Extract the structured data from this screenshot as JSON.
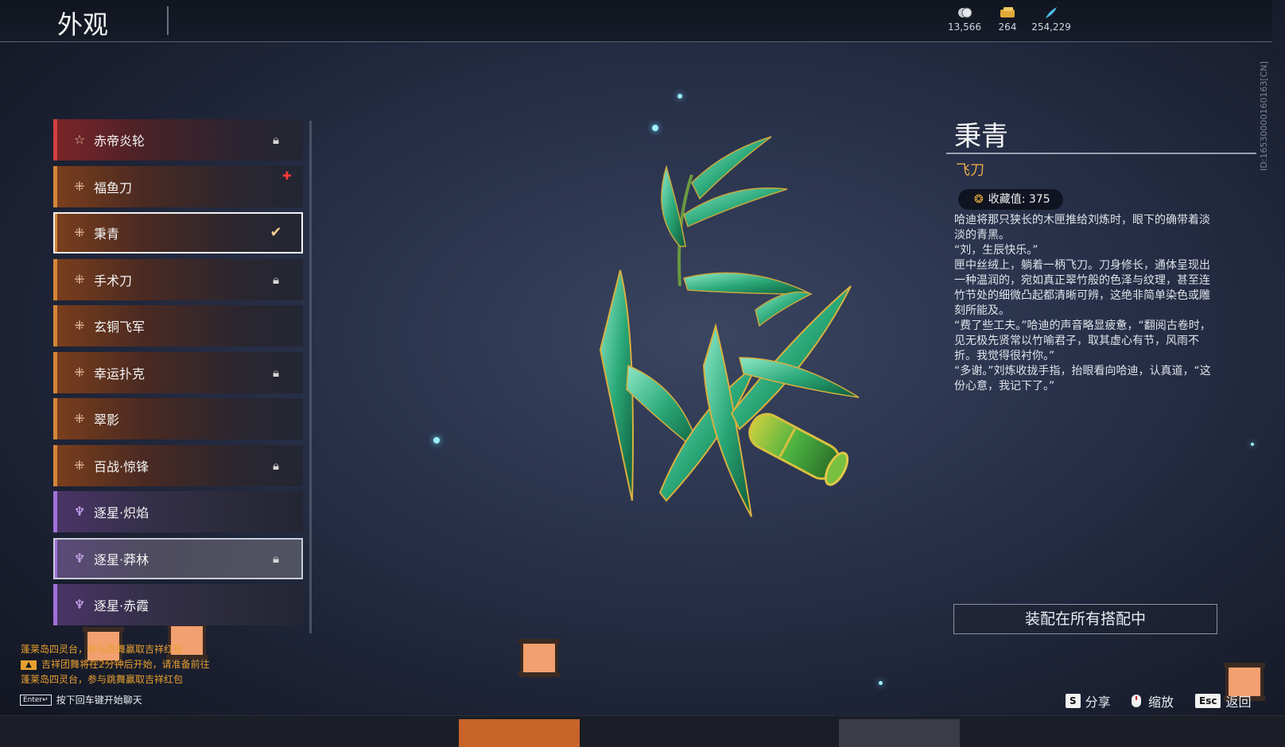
{
  "header": {
    "title": "外观"
  },
  "currencies": [
    {
      "icon": "coin-icon",
      "value": "13,566"
    },
    {
      "icon": "ticket-icon",
      "value": "264"
    },
    {
      "icon": "feather-icon",
      "value": "254,229"
    }
  ],
  "player_id": "ID:16530000160163[CN]",
  "items": [
    {
      "name": "赤帝炎轮",
      "quality": "red",
      "state": "locked"
    },
    {
      "name": "福鱼刀",
      "quality": "orange",
      "state": "new"
    },
    {
      "name": "秉青",
      "quality": "orange",
      "state": "equipped"
    },
    {
      "name": "手术刀",
      "quality": "orange",
      "state": "locked"
    },
    {
      "name": "玄铜飞军",
      "quality": "orange",
      "state": ""
    },
    {
      "name": "幸运扑克",
      "quality": "orange",
      "state": "locked"
    },
    {
      "name": "翠影",
      "quality": "orange",
      "state": ""
    },
    {
      "name": "百战·惊锋",
      "quality": "orange",
      "state": "locked"
    },
    {
      "name": "逐星·炽焰",
      "quality": "purple",
      "state": ""
    },
    {
      "name": "逐星·莽林",
      "quality": "purple",
      "state": "locked"
    },
    {
      "name": "逐星·赤霞",
      "quality": "purple",
      "state": ""
    }
  ],
  "detail": {
    "name": "秉青",
    "type": "飞刀",
    "collect_label": "收藏值: 375",
    "description": [
      "哈迪将那只狭长的木匣推给刘炼时，眼下的确带着淡淡的青黑。",
      "“刘，生辰快乐。”",
      "匣中丝绒上，躺着一柄飞刀。刀身修长，通体呈现出一种温润的，宛如真正翠竹般的色泽与纹理，甚至连竹节处的细微凸起都清晰可辨，这绝非简单染色或雕刻所能及。",
      "“费了些工夫。”哈迪的声音略显疲惫，“翻阅古卷时，见无极先贤常以竹喻君子，取其虚心有节，风雨不折。我觉得很衬你。”",
      "“多谢。”刘炼收拢手指，抬眼看向哈迪，认真道，“这份心意，我记下了。”"
    ],
    "equip_button": "装配在所有搭配中"
  },
  "hints": {
    "share_key": "S",
    "share_label": "分享",
    "zoom_label": "缩放",
    "back_key": "Esc",
    "back_label": "返回"
  },
  "chat": {
    "messages": [
      "蓬莱岛四灵台，参与跳舞赢取吉祥红包",
      "吉祥团舞将在2分钟后开始，请准备前往",
      "蓬莱岛四灵台，参与跳舞赢取吉祥红包"
    ],
    "input_key": "Enter↵",
    "input_hint": "按下回车键开始聊天"
  },
  "colors": {
    "accent_orange": "#e8a848",
    "quality_red": "#d24040",
    "quality_orange": "#d4853a",
    "quality_purple": "#a070d8"
  }
}
